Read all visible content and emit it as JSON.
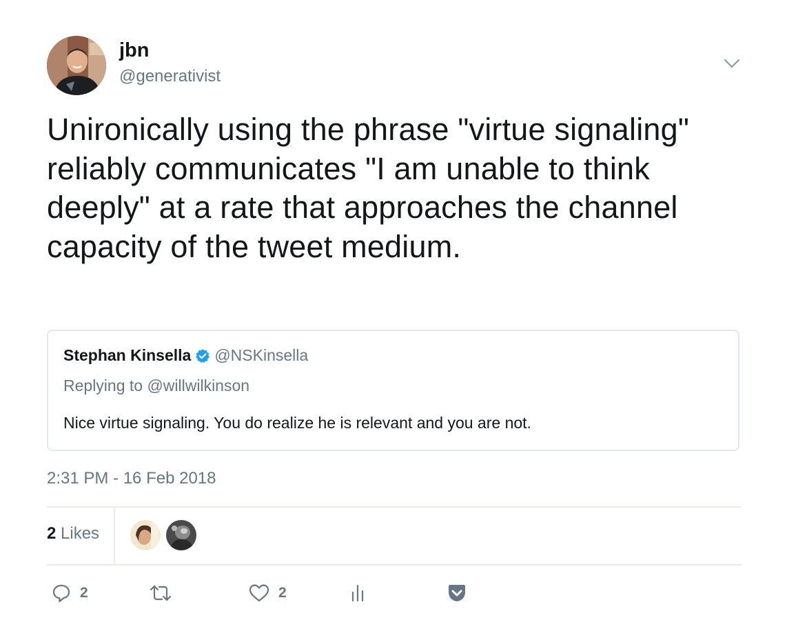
{
  "author": {
    "display_name": "jbn",
    "handle": "@generativist"
  },
  "tweet": {
    "text": "Unironically using the phrase \"virtue signaling\" reliably communicates \"I am unable to think deeply\" at a rate that approaches the channel capacity of the tweet medium.",
    "timestamp": "2:31 PM - 16 Feb 2018"
  },
  "quoted_tweet": {
    "author_name": "Stephan Kinsella",
    "verified": true,
    "handle": "@NSKinsella",
    "replying_to": "Replying to @willwilkinson",
    "text": "Nice virtue signaling. You do realize he is relevant and you are not."
  },
  "stats": {
    "likes_count": "2",
    "likes_label": "Likes"
  },
  "actions": {
    "reply_count": "2",
    "retweet_count": "",
    "like_count": "2"
  },
  "colors": {
    "text_primary": "#14171a",
    "text_secondary": "#657786",
    "border": "#e1e8ed",
    "verified_blue": "#1da1f2",
    "icon_gray": "#657786"
  },
  "icons": {
    "caret": "chevron-down-icon",
    "verified": "verified-badge-icon",
    "reply": "reply-icon",
    "retweet": "retweet-icon",
    "like": "heart-icon",
    "analytics": "analytics-icon",
    "pocket": "pocket-icon"
  }
}
